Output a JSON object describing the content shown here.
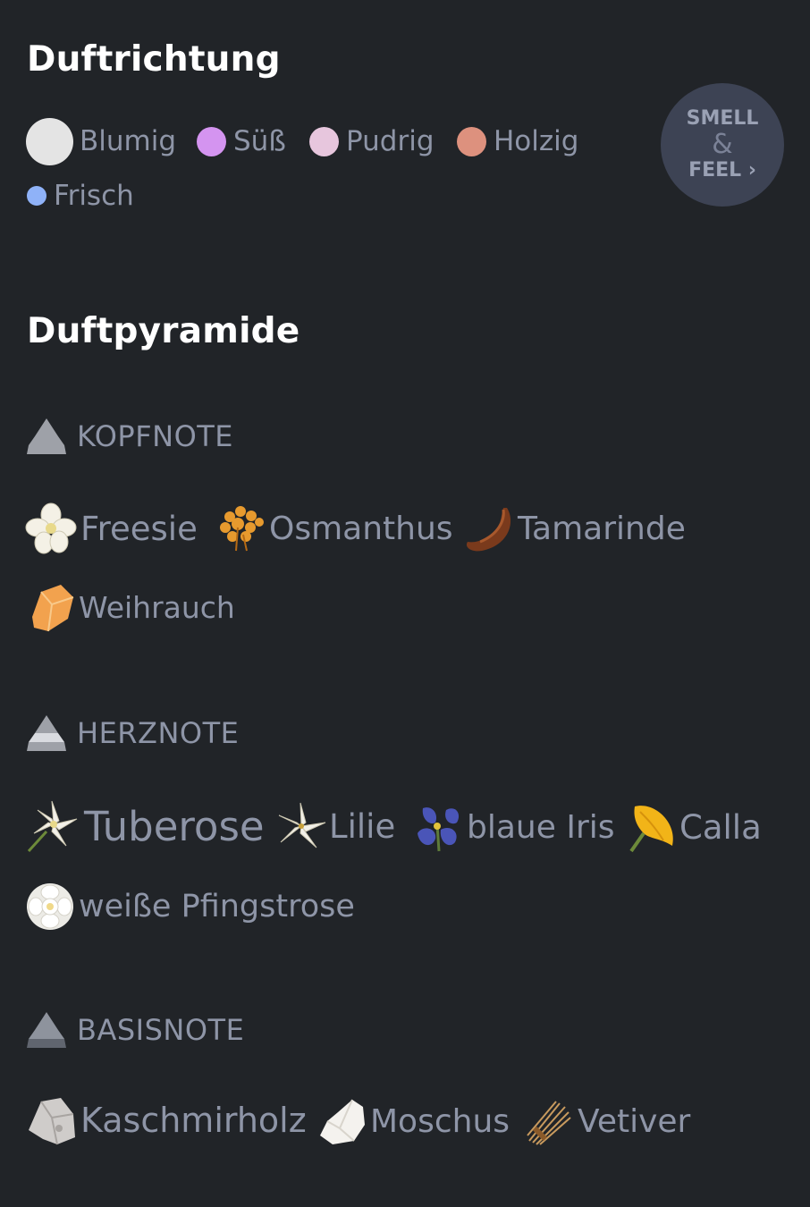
{
  "direction": {
    "title": "Duftrichtung",
    "items": [
      {
        "label": "Blumig",
        "color": "#e4e4e4"
      },
      {
        "label": "Süß",
        "color": "#d494f0"
      },
      {
        "label": "Pudrig",
        "color": "#e7c6dd"
      },
      {
        "label": "Holzig",
        "color": "#dd917e"
      },
      {
        "label": "Frisch",
        "color": "#8fb2f8"
      }
    ]
  },
  "smell_feel": {
    "line1": "SMELL",
    "amp": "&",
    "line2": "FEEL",
    "chevron": "›"
  },
  "pyramid": {
    "title": "Duftpyramide",
    "tiers": [
      {
        "label": "KOPFNOTE",
        "notes": [
          {
            "label": "Freesie",
            "icon": "freesia-icon"
          },
          {
            "label": "Osmanthus",
            "icon": "osmanthus-icon"
          },
          {
            "label": "Tamarinde",
            "icon": "tamarind-icon"
          },
          {
            "label": "Weihrauch",
            "icon": "frankincense-icon"
          }
        ]
      },
      {
        "label": "HERZNOTE",
        "notes": [
          {
            "label": "Tuberose",
            "icon": "tuberose-icon"
          },
          {
            "label": "Lilie",
            "icon": "lily-icon"
          },
          {
            "label": "blaue Iris",
            "icon": "iris-icon"
          },
          {
            "label": "Calla",
            "icon": "calla-icon"
          },
          {
            "label": "weiße Pfingstrose",
            "icon": "peony-icon"
          }
        ]
      },
      {
        "label": "BASISNOTE",
        "notes": [
          {
            "label": "Kaschmirholz",
            "icon": "cashmere-wood-icon"
          },
          {
            "label": "Moschus",
            "icon": "musk-icon"
          },
          {
            "label": "Vetiver",
            "icon": "vetiver-icon"
          }
        ]
      }
    ]
  }
}
